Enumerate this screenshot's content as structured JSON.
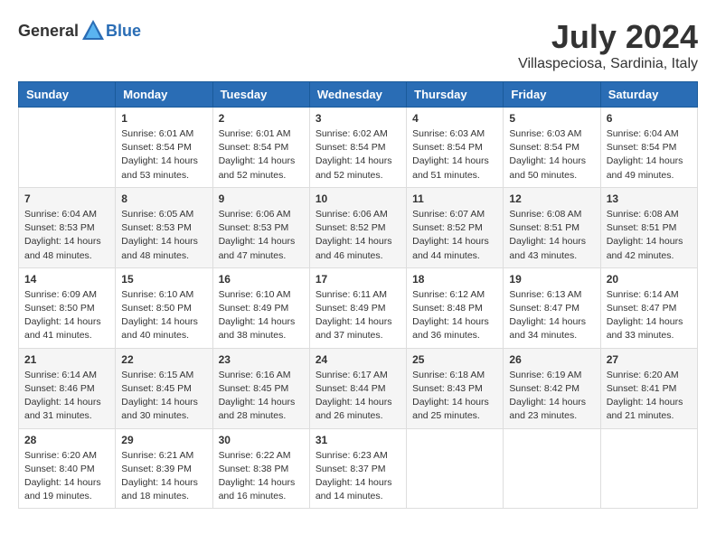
{
  "header": {
    "logo_general": "General",
    "logo_blue": "Blue",
    "month": "July 2024",
    "location": "Villaspeciosa, Sardinia, Italy"
  },
  "weekdays": [
    "Sunday",
    "Monday",
    "Tuesday",
    "Wednesday",
    "Thursday",
    "Friday",
    "Saturday"
  ],
  "weeks": [
    [
      {
        "day": "",
        "sunrise": "",
        "sunset": "",
        "daylight": ""
      },
      {
        "day": "1",
        "sunrise": "Sunrise: 6:01 AM",
        "sunset": "Sunset: 8:54 PM",
        "daylight": "Daylight: 14 hours and 53 minutes."
      },
      {
        "day": "2",
        "sunrise": "Sunrise: 6:01 AM",
        "sunset": "Sunset: 8:54 PM",
        "daylight": "Daylight: 14 hours and 52 minutes."
      },
      {
        "day": "3",
        "sunrise": "Sunrise: 6:02 AM",
        "sunset": "Sunset: 8:54 PM",
        "daylight": "Daylight: 14 hours and 52 minutes."
      },
      {
        "day": "4",
        "sunrise": "Sunrise: 6:03 AM",
        "sunset": "Sunset: 8:54 PM",
        "daylight": "Daylight: 14 hours and 51 minutes."
      },
      {
        "day": "5",
        "sunrise": "Sunrise: 6:03 AM",
        "sunset": "Sunset: 8:54 PM",
        "daylight": "Daylight: 14 hours and 50 minutes."
      },
      {
        "day": "6",
        "sunrise": "Sunrise: 6:04 AM",
        "sunset": "Sunset: 8:54 PM",
        "daylight": "Daylight: 14 hours and 49 minutes."
      }
    ],
    [
      {
        "day": "7",
        "sunrise": "Sunrise: 6:04 AM",
        "sunset": "Sunset: 8:53 PM",
        "daylight": "Daylight: 14 hours and 48 minutes."
      },
      {
        "day": "8",
        "sunrise": "Sunrise: 6:05 AM",
        "sunset": "Sunset: 8:53 PM",
        "daylight": "Daylight: 14 hours and 48 minutes."
      },
      {
        "day": "9",
        "sunrise": "Sunrise: 6:06 AM",
        "sunset": "Sunset: 8:53 PM",
        "daylight": "Daylight: 14 hours and 47 minutes."
      },
      {
        "day": "10",
        "sunrise": "Sunrise: 6:06 AM",
        "sunset": "Sunset: 8:52 PM",
        "daylight": "Daylight: 14 hours and 46 minutes."
      },
      {
        "day": "11",
        "sunrise": "Sunrise: 6:07 AM",
        "sunset": "Sunset: 8:52 PM",
        "daylight": "Daylight: 14 hours and 44 minutes."
      },
      {
        "day": "12",
        "sunrise": "Sunrise: 6:08 AM",
        "sunset": "Sunset: 8:51 PM",
        "daylight": "Daylight: 14 hours and 43 minutes."
      },
      {
        "day": "13",
        "sunrise": "Sunrise: 6:08 AM",
        "sunset": "Sunset: 8:51 PM",
        "daylight": "Daylight: 14 hours and 42 minutes."
      }
    ],
    [
      {
        "day": "14",
        "sunrise": "Sunrise: 6:09 AM",
        "sunset": "Sunset: 8:50 PM",
        "daylight": "Daylight: 14 hours and 41 minutes."
      },
      {
        "day": "15",
        "sunrise": "Sunrise: 6:10 AM",
        "sunset": "Sunset: 8:50 PM",
        "daylight": "Daylight: 14 hours and 40 minutes."
      },
      {
        "day": "16",
        "sunrise": "Sunrise: 6:10 AM",
        "sunset": "Sunset: 8:49 PM",
        "daylight": "Daylight: 14 hours and 38 minutes."
      },
      {
        "day": "17",
        "sunrise": "Sunrise: 6:11 AM",
        "sunset": "Sunset: 8:49 PM",
        "daylight": "Daylight: 14 hours and 37 minutes."
      },
      {
        "day": "18",
        "sunrise": "Sunrise: 6:12 AM",
        "sunset": "Sunset: 8:48 PM",
        "daylight": "Daylight: 14 hours and 36 minutes."
      },
      {
        "day": "19",
        "sunrise": "Sunrise: 6:13 AM",
        "sunset": "Sunset: 8:47 PM",
        "daylight": "Daylight: 14 hours and 34 minutes."
      },
      {
        "day": "20",
        "sunrise": "Sunrise: 6:14 AM",
        "sunset": "Sunset: 8:47 PM",
        "daylight": "Daylight: 14 hours and 33 minutes."
      }
    ],
    [
      {
        "day": "21",
        "sunrise": "Sunrise: 6:14 AM",
        "sunset": "Sunset: 8:46 PM",
        "daylight": "Daylight: 14 hours and 31 minutes."
      },
      {
        "day": "22",
        "sunrise": "Sunrise: 6:15 AM",
        "sunset": "Sunset: 8:45 PM",
        "daylight": "Daylight: 14 hours and 30 minutes."
      },
      {
        "day": "23",
        "sunrise": "Sunrise: 6:16 AM",
        "sunset": "Sunset: 8:45 PM",
        "daylight": "Daylight: 14 hours and 28 minutes."
      },
      {
        "day": "24",
        "sunrise": "Sunrise: 6:17 AM",
        "sunset": "Sunset: 8:44 PM",
        "daylight": "Daylight: 14 hours and 26 minutes."
      },
      {
        "day": "25",
        "sunrise": "Sunrise: 6:18 AM",
        "sunset": "Sunset: 8:43 PM",
        "daylight": "Daylight: 14 hours and 25 minutes."
      },
      {
        "day": "26",
        "sunrise": "Sunrise: 6:19 AM",
        "sunset": "Sunset: 8:42 PM",
        "daylight": "Daylight: 14 hours and 23 minutes."
      },
      {
        "day": "27",
        "sunrise": "Sunrise: 6:20 AM",
        "sunset": "Sunset: 8:41 PM",
        "daylight": "Daylight: 14 hours and 21 minutes."
      }
    ],
    [
      {
        "day": "28",
        "sunrise": "Sunrise: 6:20 AM",
        "sunset": "Sunset: 8:40 PM",
        "daylight": "Daylight: 14 hours and 19 minutes."
      },
      {
        "day": "29",
        "sunrise": "Sunrise: 6:21 AM",
        "sunset": "Sunset: 8:39 PM",
        "daylight": "Daylight: 14 hours and 18 minutes."
      },
      {
        "day": "30",
        "sunrise": "Sunrise: 6:22 AM",
        "sunset": "Sunset: 8:38 PM",
        "daylight": "Daylight: 14 hours and 16 minutes."
      },
      {
        "day": "31",
        "sunrise": "Sunrise: 6:23 AM",
        "sunset": "Sunset: 8:37 PM",
        "daylight": "Daylight: 14 hours and 14 minutes."
      },
      {
        "day": "",
        "sunrise": "",
        "sunset": "",
        "daylight": ""
      },
      {
        "day": "",
        "sunrise": "",
        "sunset": "",
        "daylight": ""
      },
      {
        "day": "",
        "sunrise": "",
        "sunset": "",
        "daylight": ""
      }
    ]
  ]
}
